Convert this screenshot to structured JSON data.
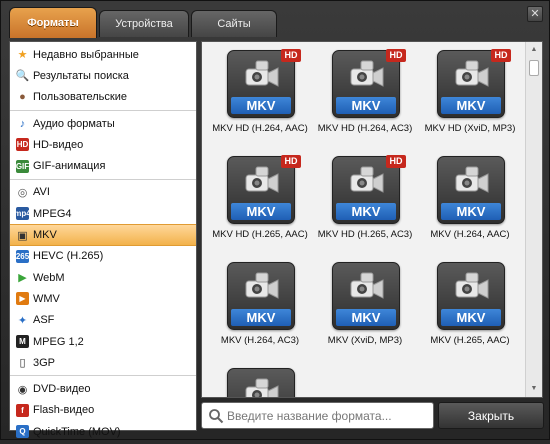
{
  "tabs": [
    {
      "label": "Форматы",
      "active": true
    },
    {
      "label": "Устройства",
      "active": false
    },
    {
      "label": "Сайты",
      "active": false
    }
  ],
  "window_close": "✕",
  "sidebar": {
    "groups": [
      [
        {
          "label": "Недавно выбранные",
          "icon": "star-icon"
        },
        {
          "label": "Результаты поиска",
          "icon": "magnifier-icon"
        },
        {
          "label": "Пользовательские",
          "icon": "user-icon"
        }
      ],
      [
        {
          "label": "Аудио форматы",
          "icon": "music-note-icon"
        },
        {
          "label": "HD-видео",
          "icon": "hd-icon"
        },
        {
          "label": "GIF-анимация",
          "icon": "gif-icon"
        }
      ],
      [
        {
          "label": "AVI",
          "icon": "avi-icon"
        },
        {
          "label": "MPEG4",
          "icon": "mpeg4-icon"
        },
        {
          "label": "MKV",
          "icon": "mkv-icon",
          "selected": true
        },
        {
          "label": "HEVC (H.265)",
          "icon": "hevc-icon"
        },
        {
          "label": "WebM",
          "icon": "webm-icon"
        },
        {
          "label": "WMV",
          "icon": "wmv-icon"
        },
        {
          "label": "ASF",
          "icon": "asf-icon"
        },
        {
          "label": "MPEG 1,2",
          "icon": "mpeg12-icon"
        },
        {
          "label": "3GP",
          "icon": "phone-icon"
        }
      ],
      [
        {
          "label": "DVD-видео",
          "icon": "dvd-icon"
        },
        {
          "label": "Flash-видео",
          "icon": "flash-icon"
        },
        {
          "label": "QuickTime (MOV)",
          "icon": "quicktime-icon"
        }
      ]
    ]
  },
  "formats": [
    {
      "caption": "MKV HD (H.264, AAC)",
      "badge": "MKV",
      "hd": "HD"
    },
    {
      "caption": "MKV HD (H.264, AC3)",
      "badge": "MKV",
      "hd": "HD"
    },
    {
      "caption": "MKV HD (XviD, MP3)",
      "badge": "MKV",
      "hd": "HD"
    },
    {
      "caption": "MKV HD (H.265, AAC)",
      "badge": "MKV",
      "hd": "HD"
    },
    {
      "caption": "MKV HD (H.265, AC3)",
      "badge": "MKV",
      "hd": "HD"
    },
    {
      "caption": "MKV (H.264, AAC)",
      "badge": "MKV",
      "hd": ""
    },
    {
      "caption": "MKV (H.264, AC3)",
      "badge": "MKV",
      "hd": ""
    },
    {
      "caption": "MKV (XviD, MP3)",
      "badge": "MKV",
      "hd": ""
    },
    {
      "caption": "MKV (H.265, AAC)",
      "badge": "MKV",
      "hd": ""
    },
    {
      "caption": "",
      "badge": "",
      "hd": ""
    }
  ],
  "search": {
    "placeholder": "Введите название формата..."
  },
  "close_button": "Закрыть",
  "colors": {
    "accent": "#e8a24d",
    "mkv_badge": "#2a6fc6",
    "hd_badge": "#c6281d"
  }
}
